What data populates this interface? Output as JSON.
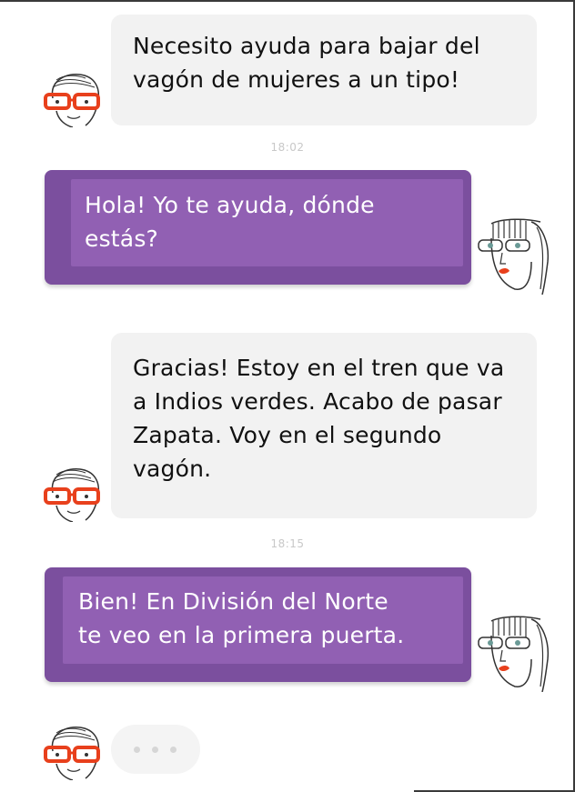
{
  "colors": {
    "incoming_bubble": "#f2f2f2",
    "outgoing_bubble": "#7b4f9e",
    "outgoing_inner": "#9160b3",
    "timestamp": "#c8c8c8",
    "glasses_red": "#e8401c"
  },
  "messages": [
    {
      "side": "incoming",
      "avatar": "woman-red-glasses-avatar",
      "text": "Necesito ayuda para bajar del\nvagón de mujeres a un tipo!"
    },
    {
      "timestamp": "18:02"
    },
    {
      "side": "outgoing",
      "avatar": "woman-bangs-avatar",
      "text": "Hola! Yo te ayuda, dónde\nestás?"
    },
    {
      "side": "incoming",
      "avatar": "woman-red-glasses-avatar",
      "text": "Gracias! Estoy en el tren que va\na Indios verdes. Acabo de pasar\nZapata. Voy en el segundo\nvagón."
    },
    {
      "timestamp": "18:15"
    },
    {
      "side": "outgoing",
      "avatar": "woman-bangs-avatar",
      "text": "Bien! En División del Norte\nte veo en la primera puerta."
    },
    {
      "side": "incoming",
      "avatar": "woman-red-glasses-avatar",
      "typing_indicator": "ellipsis-icon"
    }
  ]
}
